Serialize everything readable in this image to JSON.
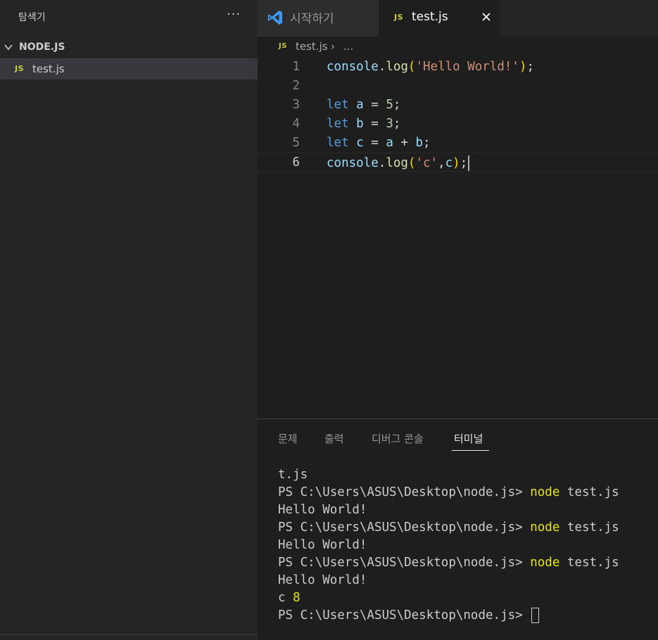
{
  "sidebar": {
    "title": "탐색기",
    "more": "···",
    "folder": "NODE.JS",
    "file": {
      "badge": "JS",
      "label": "test.js"
    }
  },
  "tabs": {
    "welcome": {
      "label": "시작하기",
      "icon": "vscode-icon"
    },
    "active": {
      "badge": "JS",
      "label": "test.js",
      "close": "close-icon"
    }
  },
  "breadcrumb": {
    "badge": "JS",
    "file": "test.js",
    "separator": "›",
    "more": "..."
  },
  "editor": {
    "lines": [
      {
        "num": "1"
      },
      {
        "num": "2"
      },
      {
        "num": "3"
      },
      {
        "num": "4"
      },
      {
        "num": "5"
      },
      {
        "num": "6"
      }
    ],
    "tokens": {
      "console": "console",
      "dot": ".",
      "log": "log",
      "lparen": "(",
      "rparen": ")",
      "semi": ";",
      "hello": "'Hello World!'",
      "let": "let",
      "a": "a",
      "b": "b",
      "c": "c",
      "eq": " = ",
      "plus": " + ",
      "five": "5",
      "three": "3",
      "str_c": "'c'",
      "comma": ","
    }
  },
  "panel": {
    "tabs": [
      "문제",
      "출력",
      "디버그 콘솔",
      "터미널"
    ],
    "active_tab": "터미널",
    "terminal": {
      "first_line": "t.js",
      "prompt": "PS C:\\Users\\ASUS\\Desktop\\node.js> ",
      "cmd": "node",
      "arg": " test.js",
      "output": "Hello World!",
      "c_label": "c ",
      "c_value": "8"
    }
  },
  "colors": {
    "background": "#1e1e1e",
    "sidebar": "#252526",
    "js_badge": "#cbcb41",
    "keyword": "#569cd6",
    "string": "#ce9178",
    "function": "#dcdcaa",
    "variable": "#9cdcfe",
    "number": "#b5cea8",
    "terminal_highlight": "#e5e510"
  }
}
